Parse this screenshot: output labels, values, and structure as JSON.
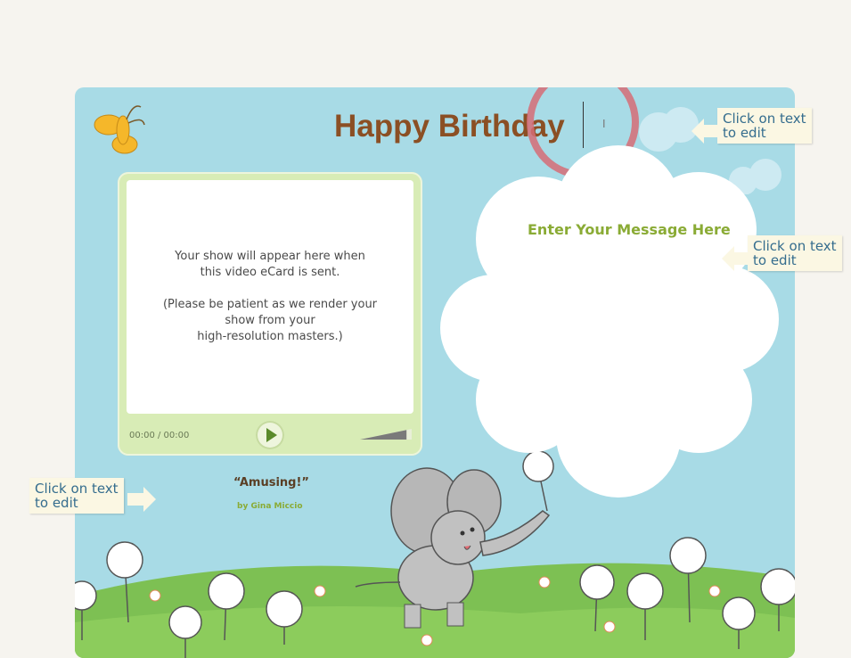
{
  "card": {
    "title": "Happy Birthday"
  },
  "player": {
    "screen_lines_1": [
      "Your show will appear here when",
      "this video eCard is sent."
    ],
    "screen_lines_2": [
      "(Please be patient as we render your",
      "show from your",
      "high-resolution masters.)"
    ],
    "time": "00:00 / 00:00",
    "volume_level": 0.9
  },
  "message": {
    "text": "Enter Your Message Here"
  },
  "credit": {
    "quote": "“Amusing!”",
    "author": "by Gina Miccio"
  },
  "tips": [
    {
      "text_lines": [
        "Click on text",
        "to edit"
      ]
    },
    {
      "text_lines": [
        "Click on text",
        "to edit"
      ]
    },
    {
      "text_lines": [
        "Click on text",
        "to edit"
      ]
    }
  ],
  "colors": {
    "card_background": "#a8dbe6",
    "title": "#8b4f24",
    "accent_green": "#8aab35",
    "tip_text": "#356d8e"
  }
}
